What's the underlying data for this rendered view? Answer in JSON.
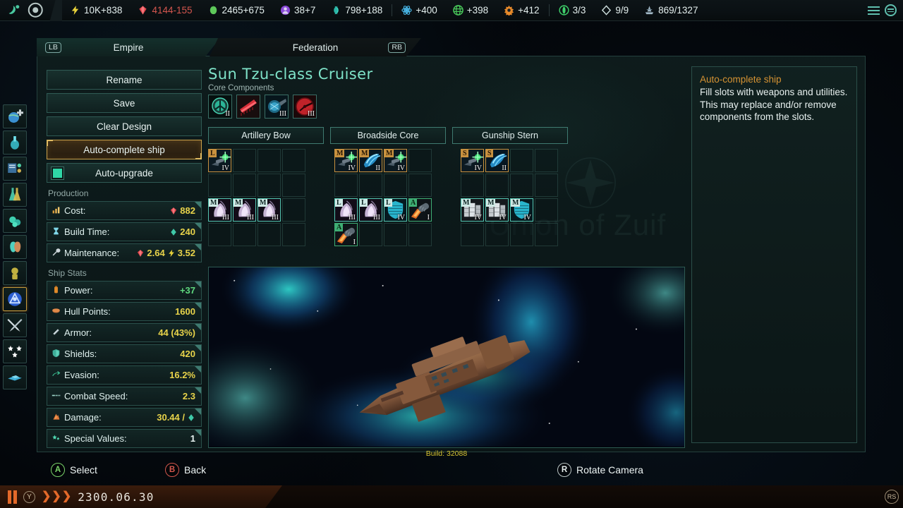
{
  "topbar": {
    "emblem_icons": [
      "species-emblem-icon",
      "empire-emblem-icon"
    ],
    "resources": [
      {
        "icon": "influence-icon",
        "name": "influence",
        "value": "10K+838",
        "negative": false
      },
      {
        "icon": "minerals-icon",
        "name": "minerals",
        "value": "4144-155",
        "negative": true
      },
      {
        "icon": "food-icon",
        "name": "food",
        "value": "2465+675",
        "negative": false
      },
      {
        "icon": "consumer-goods-icon",
        "name": "consumer-goods",
        "value": "38+7",
        "negative": false
      },
      {
        "icon": "alloys-icon",
        "name": "alloys",
        "value": "798+188",
        "negative": false
      },
      {
        "icon": "physics-icon",
        "name": "physics",
        "value": "+400",
        "negative": false
      },
      {
        "icon": "society-icon",
        "name": "society",
        "value": "+398",
        "negative": false
      },
      {
        "icon": "engineering-icon",
        "name": "engineering",
        "value": "+412",
        "negative": false
      },
      {
        "icon": "unity-icon",
        "name": "unity",
        "value": "3/3",
        "negative": false
      },
      {
        "icon": "envoys-icon",
        "name": "envoys",
        "value": "9/9",
        "negative": false
      },
      {
        "icon": "naval-capacity-icon",
        "name": "naval-capacity",
        "value": "869/1327",
        "negative": false
      }
    ]
  },
  "rail": {
    "items": [
      {
        "name": "sidebar-item-planets",
        "icon": "planet-plus-icon",
        "glyph": "🌍",
        "selected": false
      },
      {
        "name": "sidebar-item-species",
        "icon": "species-icon",
        "glyph": "🧪",
        "selected": false
      },
      {
        "name": "sidebar-item-policies",
        "icon": "policies-icon",
        "glyph": "🗂",
        "selected": false
      },
      {
        "name": "sidebar-item-technology",
        "icon": "technology-icon",
        "glyph": "⚗",
        "selected": false
      },
      {
        "name": "sidebar-item-situations",
        "icon": "situations-icon",
        "glyph": "🔮",
        "selected": false
      },
      {
        "name": "sidebar-item-factions",
        "icon": "factions-icon",
        "glyph": "🎭",
        "selected": false
      },
      {
        "name": "sidebar-item-espionage",
        "icon": "espionage-icon",
        "glyph": "👁",
        "selected": false
      },
      {
        "name": "sidebar-item-fleets",
        "icon": "fleet-manager-icon",
        "glyph": "◈",
        "selected": true
      },
      {
        "name": "sidebar-item-war",
        "icon": "crossed-swords-icon",
        "glyph": "⚔",
        "selected": false
      },
      {
        "name": "sidebar-item-contacts",
        "icon": "stars-icon",
        "glyph": "★",
        "selected": false
      },
      {
        "name": "sidebar-item-ship-designer",
        "icon": "ship-designer-icon",
        "glyph": "🛸",
        "selected": false
      }
    ]
  },
  "tabs": [
    {
      "name": "tab-empire",
      "label": "Empire",
      "pad": "LB",
      "active": true
    },
    {
      "name": "tab-federation",
      "label": "Federation",
      "pad": "RB",
      "active": false
    }
  ],
  "left_panel": {
    "buttons": [
      {
        "name": "rename-button",
        "label": "Rename",
        "style": "normal"
      },
      {
        "name": "save-button",
        "label": "Save",
        "style": "normal"
      },
      {
        "name": "clear-design-button",
        "label": "Clear Design",
        "style": "normal"
      },
      {
        "name": "auto-complete-ship-button",
        "label": "Auto-complete ship",
        "style": "highlight"
      },
      {
        "name": "auto-upgrade-toggle",
        "label": "Auto-upgrade",
        "style": "checkbox",
        "checked": true
      }
    ],
    "production_header": "Production",
    "production": [
      {
        "name": "cost-stat",
        "icon": "cost-icon",
        "label": "Cost:",
        "value": "882",
        "value_icon": "minerals-icon",
        "color": "yellow"
      },
      {
        "name": "build-time-stat",
        "icon": "hourglass-icon",
        "label": "Build Time:",
        "value": "240",
        "value_icon": "time-icon",
        "color": "yellow"
      },
      {
        "name": "maintenance-stat",
        "icon": "wrench-icon",
        "label": "Maintenance:",
        "value": "2.64",
        "value_icon": "minerals-icon",
        "value2": "3.52",
        "value2_icon": "energy-icon",
        "color": "yellow"
      }
    ],
    "stats_header": "Ship Stats",
    "stats": [
      {
        "name": "power-stat",
        "icon": "power-icon",
        "label": "Power:",
        "value": "+37",
        "color": "green"
      },
      {
        "name": "hull-points-stat",
        "icon": "hull-icon",
        "label": "Hull Points:",
        "value": "1600",
        "color": "yellow"
      },
      {
        "name": "armor-stat",
        "icon": "armor-icon",
        "label": "Armor:",
        "value": "44 (43%)",
        "color": "yellow"
      },
      {
        "name": "shields-stat",
        "icon": "shield-icon",
        "label": "Shields:",
        "value": "420",
        "color": "yellow"
      },
      {
        "name": "evasion-stat",
        "icon": "evasion-icon",
        "label": "Evasion:",
        "value": "16.2%",
        "color": "yellow"
      },
      {
        "name": "combat-speed-stat",
        "icon": "speed-icon",
        "label": "Combat Speed:",
        "value": "2.3",
        "color": "yellow"
      },
      {
        "name": "damage-stat",
        "icon": "damage-icon",
        "label": "Damage:",
        "value": "30.44 /",
        "value_icon": "time-icon",
        "color": "yellow"
      },
      {
        "name": "special-values-stat",
        "icon": "special-values-icon",
        "label": "Special Values:",
        "value": "1",
        "color": "white"
      }
    ]
  },
  "center": {
    "ship_title": "Sun Tzu-class Cruiser",
    "core_components_label": "Core Components",
    "core_components": [
      {
        "name": "reactor-component",
        "icon": "reactor-icon",
        "tier": "II",
        "art": "reactor"
      },
      {
        "name": "thruster-component",
        "icon": "thruster-icon",
        "tier": "",
        "art": "thruster"
      },
      {
        "name": "sensor-component",
        "icon": "sensor-icon",
        "tier": "III",
        "art": "sensor"
      },
      {
        "name": "combat-computer-component",
        "icon": "combat-computer-icon",
        "tier": "III",
        "art": "computer"
      }
    ],
    "sections": [
      {
        "name": "section-artillery-bow",
        "label": "Artillery Bow",
        "rows": [
          [
            {
              "filled": true,
              "size": "L",
              "size_kind": "o",
              "tier": "IV",
              "art": "laser",
              "name": "weapon-slot"
            },
            {
              "filled": false,
              "name": "empty-slot"
            },
            {
              "filled": false,
              "name": "empty-slot"
            },
            {
              "filled": false,
              "name": "empty-slot"
            }
          ],
          [
            {
              "filled": false,
              "name": "empty-slot"
            },
            {
              "filled": false,
              "name": "empty-slot"
            },
            {
              "filled": false,
              "name": "empty-slot"
            },
            {
              "filled": false,
              "name": "empty-slot"
            }
          ],
          [
            {
              "filled": true,
              "size": "M",
              "size_kind": "t",
              "tier": "III",
              "art": "armor",
              "name": "utility-slot"
            },
            {
              "filled": true,
              "size": "M",
              "size_kind": "t",
              "tier": "III",
              "art": "armor",
              "name": "utility-slot"
            },
            {
              "filled": true,
              "size": "M",
              "size_kind": "t",
              "tier": "III",
              "art": "armor",
              "name": "utility-slot"
            },
            {
              "filled": false,
              "name": "empty-slot"
            }
          ],
          [
            {
              "filled": false,
              "name": "empty-slot"
            },
            {
              "filled": false,
              "name": "empty-slot"
            },
            {
              "filled": false,
              "name": "empty-slot"
            },
            {
              "filled": false,
              "name": "empty-slot"
            }
          ]
        ]
      },
      {
        "name": "section-broadside-core",
        "label": "Broadside Core",
        "rows": [
          [
            {
              "filled": true,
              "size": "M",
              "size_kind": "o",
              "tier": "IV",
              "art": "laser",
              "name": "weapon-slot"
            },
            {
              "filled": true,
              "size": "M",
              "size_kind": "o",
              "tier": "II",
              "art": "missile",
              "name": "weapon-slot"
            },
            {
              "filled": true,
              "size": "M",
              "size_kind": "o",
              "tier": "IV",
              "art": "laser",
              "name": "weapon-slot"
            },
            {
              "filled": false,
              "name": "empty-slot"
            }
          ],
          [
            {
              "filled": false,
              "name": "empty-slot"
            },
            {
              "filled": false,
              "name": "empty-slot"
            },
            {
              "filled": false,
              "name": "empty-slot"
            },
            {
              "filled": false,
              "name": "empty-slot"
            }
          ],
          [
            {
              "filled": true,
              "size": "L",
              "size_kind": "t",
              "tier": "III",
              "art": "armor",
              "name": "utility-slot"
            },
            {
              "filled": true,
              "size": "L",
              "size_kind": "t",
              "tier": "III",
              "art": "armor",
              "name": "utility-slot"
            },
            {
              "filled": true,
              "size": "L",
              "size_kind": "t",
              "tier": "IV",
              "art": "shield",
              "name": "utility-slot"
            },
            {
              "filled": true,
              "size": "A",
              "size_kind": "g",
              "tier": "I",
              "art": "aux",
              "name": "aux-slot"
            }
          ],
          [
            {
              "filled": true,
              "size": "A",
              "size_kind": "g",
              "tier": "I",
              "art": "aux",
              "name": "aux-slot"
            },
            {
              "filled": false,
              "name": "empty-slot"
            },
            {
              "filled": false,
              "name": "empty-slot"
            },
            {
              "filled": false,
              "name": "empty-slot"
            }
          ]
        ]
      },
      {
        "name": "section-gunship-stern",
        "label": "Gunship Stern",
        "rows": [
          [
            {
              "filled": true,
              "size": "S",
              "size_kind": "o",
              "tier": "IV",
              "art": "laser",
              "name": "weapon-slot"
            },
            {
              "filled": true,
              "size": "S",
              "size_kind": "o",
              "tier": "II",
              "art": "missile",
              "name": "weapon-slot"
            },
            {
              "filled": false,
              "name": "empty-slot"
            },
            {
              "filled": false,
              "name": "empty-slot"
            }
          ],
          [
            {
              "filled": false,
              "name": "empty-slot"
            },
            {
              "filled": false,
              "name": "empty-slot"
            },
            {
              "filled": false,
              "name": "empty-slot"
            },
            {
              "filled": false,
              "name": "empty-slot"
            }
          ],
          [
            {
              "filled": true,
              "size": "M",
              "size_kind": "t",
              "tier": "IV",
              "art": "plate",
              "name": "utility-slot"
            },
            {
              "filled": true,
              "size": "M",
              "size_kind": "t",
              "tier": "IV",
              "art": "plate",
              "name": "utility-slot"
            },
            {
              "filled": true,
              "size": "M",
              "size_kind": "t",
              "tier": "IV",
              "art": "shield",
              "name": "utility-slot"
            },
            {
              "filled": false,
              "name": "empty-slot"
            }
          ],
          [
            {
              "filled": false,
              "name": "empty-slot"
            },
            {
              "filled": false,
              "name": "empty-slot"
            },
            {
              "filled": false,
              "name": "empty-slot"
            },
            {
              "filled": false,
              "name": "empty-slot"
            }
          ]
        ]
      }
    ],
    "build_label": "Build: 32088",
    "watermark": "Union of Zuif"
  },
  "tooltip": {
    "title": "Auto-complete ship",
    "body": "Fill slots with weapons and utilities. This may replace and/or remove components from the slots."
  },
  "hints": [
    {
      "name": "hint-select",
      "button": "A",
      "label": "Select",
      "kind": "a"
    },
    {
      "name": "hint-back",
      "button": "B",
      "label": "Back",
      "kind": "b"
    },
    {
      "name": "hint-rotate-camera",
      "button": "R",
      "label": "Rotate Camera",
      "kind": "r"
    }
  ],
  "statusbar": {
    "date": "2300.06.30",
    "pause_button": "Y",
    "speed_arrows": 3,
    "right_button": "RS"
  },
  "colors": {
    "accent_teal": "#7fe3c9",
    "accent_gold": "#caa04a",
    "value_yellow": "#e8d34a",
    "value_green": "#5fd97e",
    "negative_red": "#d4564e",
    "tooltip_title": "#d59233",
    "panel_bg": "#0e1c1c",
    "panel_border": "#24403d",
    "status_orange": "#e4692a"
  }
}
